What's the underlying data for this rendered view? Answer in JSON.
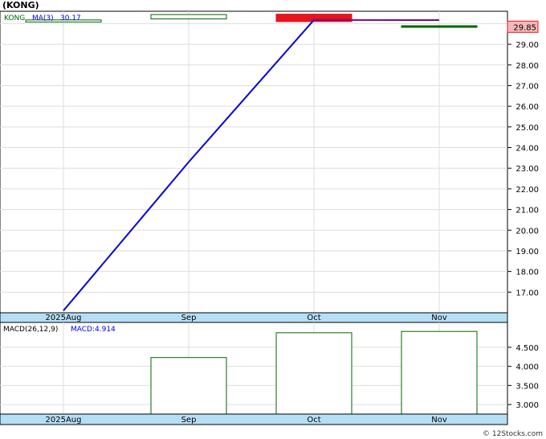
{
  "chart_data": [
    {
      "type": "candlestick",
      "title": "(KONG)",
      "legend": {
        "symbol": "KONG",
        "ma_label": "MA(3)",
        "ma_value": "30.17"
      },
      "x_labels": [
        "2025Aug",
        "Sep",
        "Oct",
        "Nov"
      ],
      "ylim": [
        16.0,
        30.6
      ],
      "yticks": [
        17,
        18,
        19,
        20,
        21,
        22,
        23,
        24,
        25,
        26,
        27,
        28,
        29,
        30
      ],
      "ytick_labels": [
        "17.00",
        "18.00",
        "19.00",
        "20.00",
        "21.00",
        "22.00",
        "23.00",
        "24.00",
        "25.00",
        "26.00",
        "27.00",
        "28.00",
        "29.00",
        "30.00"
      ],
      "last_price": "29.85",
      "candles": [
        {
          "label": "2025Aug",
          "open": 30.08,
          "close": 30.18,
          "color": "up"
        },
        {
          "label": "Sep",
          "open": 30.23,
          "close": 30.44,
          "color": "up"
        },
        {
          "label": "Oct",
          "open": 30.46,
          "close": 30.1,
          "color": "down"
        },
        {
          "label": "Nov",
          "open": 29.82,
          "close": 29.9,
          "color": "flat"
        }
      ],
      "ma_series": {
        "name": "MA(3)",
        "values": [
          16.1,
          23.3,
          30.18,
          30.17
        ]
      },
      "colors": {
        "up": "#006600",
        "down": "#e8141d",
        "ma": "#0000dd",
        "axis_band": "#b6dff5",
        "last_box": "#f4b8b8"
      }
    },
    {
      "type": "bar",
      "legend": {
        "label": "MACD(26,12,9)",
        "macd_label": "MACD:4.914"
      },
      "x_labels": [
        "2025Aug",
        "Sep",
        "Oct",
        "Nov"
      ],
      "ylim": [
        2.75,
        5.15
      ],
      "yticks": [
        3.0,
        3.5,
        4.0,
        4.5
      ],
      "ytick_labels": [
        "3.000",
        "3.500",
        "4.000",
        "4.500"
      ],
      "values": [
        null,
        4.23,
        4.88,
        4.914
      ],
      "colors": {
        "bar_edge": "#006600"
      }
    }
  ],
  "watermark": "© 12Stocks.com"
}
